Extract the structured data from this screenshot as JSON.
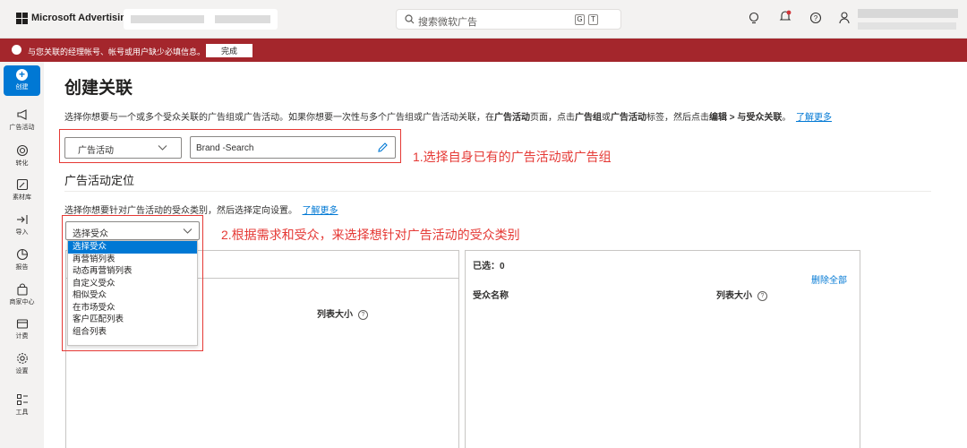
{
  "topbar": {
    "brand": "Microsoft Advertising",
    "search_placeholder": "搜索微软广告",
    "kbd_g": "G",
    "kbd_t": "T"
  },
  "alert": {
    "message": "与您关联的经理帐号、帐号或用户缺少必填信息。",
    "button": "完成"
  },
  "leftnav": {
    "create": "创建",
    "items": [
      {
        "label": "广告活动",
        "icon": "megaphone-icon"
      },
      {
        "label": "转化",
        "icon": "target-icon"
      },
      {
        "label": "素材库",
        "icon": "image-edit-icon"
      },
      {
        "label": "导入",
        "icon": "import-icon"
      },
      {
        "label": "报告",
        "icon": "report-icon"
      },
      {
        "label": "商家中心",
        "icon": "shopping-bag-icon"
      },
      {
        "label": "计费",
        "icon": "billing-icon"
      },
      {
        "label": "设置",
        "icon": "gear-icon"
      },
      {
        "label": "工具",
        "icon": "tools-icon"
      }
    ]
  },
  "main": {
    "title": "创建关联",
    "desc_1": "选择你想要与一个或多个受众关联的广告组或广告活动。如果你想要一次性与多个广告组或广告活动关联，在",
    "desc_b1": "广告活动",
    "desc_2": "页面，点击",
    "desc_b2": "广告组",
    "desc_3": "或",
    "desc_b3": "广告活动",
    "desc_4": "标签，然后点击",
    "desc_b4": "编辑 > 与受众关联",
    "desc_5": "。",
    "desc_link": "了解更多",
    "type_select": "广告活动",
    "campaign_value": "Brand -Search",
    "section_title": "广告活动定位",
    "desc2": "选择你想要针对广告活动的受众类别，然后选择定向设置。",
    "desc2_link": "了解更多",
    "audience_select": "选择受众",
    "audience_options": [
      "选择受众",
      "再营销列表",
      "动态再营销列表",
      "自定义受众",
      "相似受众",
      "在市场受众",
      "客户匹配列表",
      "组合列表"
    ],
    "left_col_size": "列表大小",
    "selected_label": "已选：0",
    "remove_all": "删除全部",
    "right_col_name": "受众名称",
    "right_col_size": "列表大小"
  },
  "annotations": {
    "note1": "1.选择自身已有的广告活动或广告组",
    "note2": "2.根据需求和受众，来选择想针对广告活动的受众类别",
    "color": "#e53935"
  }
}
